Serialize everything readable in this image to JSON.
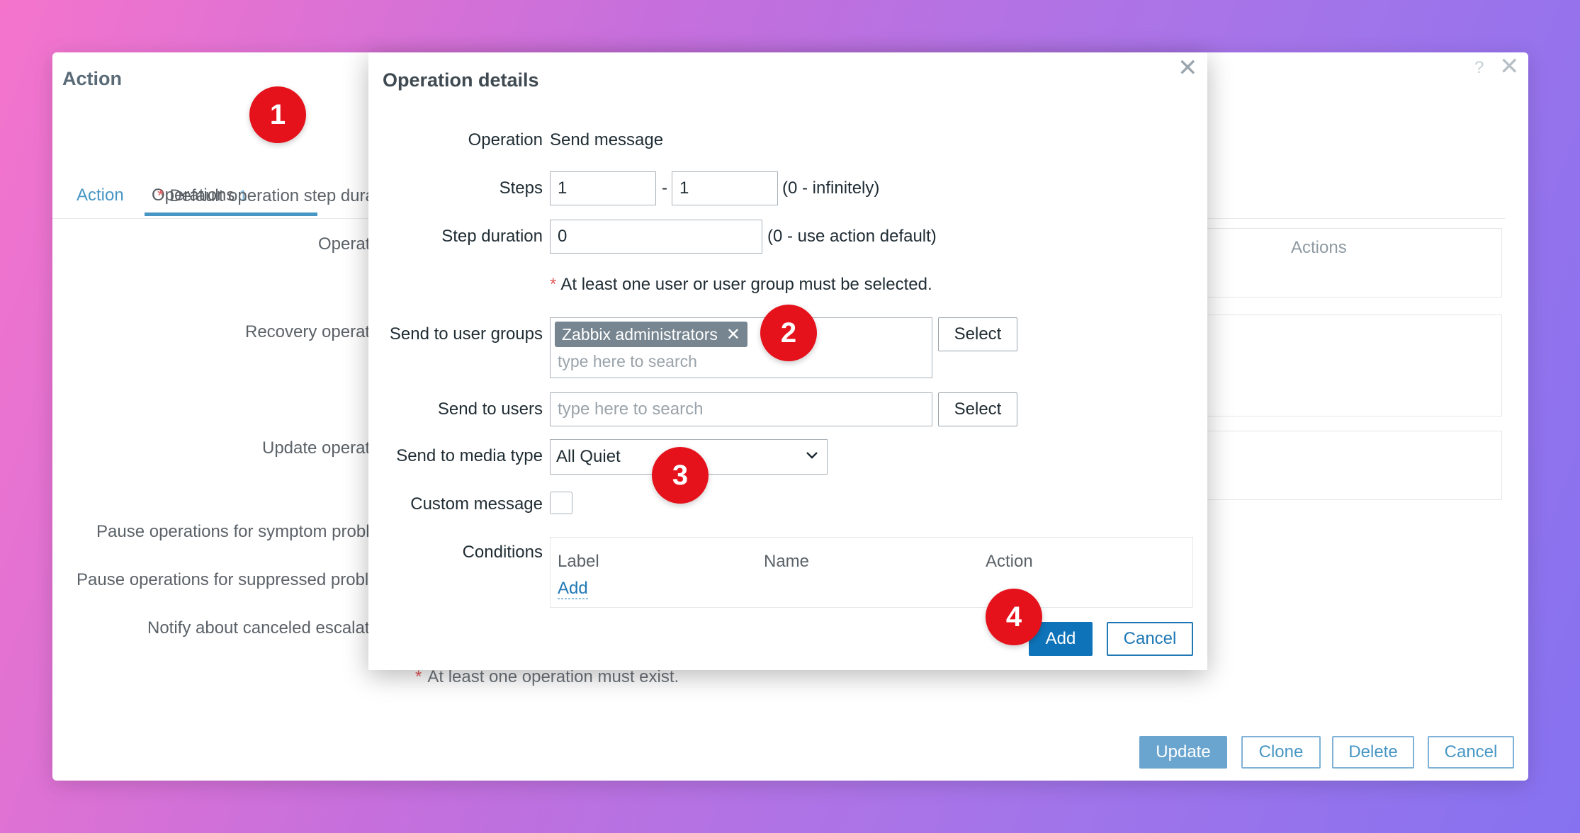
{
  "window": {
    "title": "Action",
    "help_icon": "?",
    "close_icon": "✕",
    "tabs": [
      {
        "label": "Action"
      },
      {
        "label": "Operations",
        "count": "1"
      }
    ],
    "labels": {
      "default_step": "Default operation step dura",
      "operations": "Operat",
      "recovery": "Recovery operat",
      "update": "Update operat",
      "pause_symptom": "Pause operations for symptom probl",
      "pause_suppressed": "Pause operations for suppressed probl",
      "notify_canceled": "Notify about canceled escalat"
    },
    "required_mark": "*",
    "actions_header": "Actions",
    "note": "At least one operation must exist.",
    "buttons": {
      "update": "Update",
      "clone": "Clone",
      "delete": "Delete",
      "cancel": "Cancel"
    }
  },
  "modal": {
    "title": "Operation details",
    "close_icon": "✕",
    "operation": {
      "label": "Operation",
      "value": "Send message"
    },
    "steps": {
      "label": "Steps",
      "from": "1",
      "separator": "-",
      "to": "1",
      "hint": "(0 - infinitely)"
    },
    "step_duration": {
      "label": "Step duration",
      "value": "0",
      "hint": "(0 - use action default)"
    },
    "required_note": "At least one user or user group must be selected.",
    "required_mark": "*",
    "user_groups": {
      "label": "Send to user groups",
      "chip": "Zabbix administrators",
      "chip_remove": "✕",
      "placeholder": "type here to search",
      "select_label": "Select"
    },
    "users": {
      "label": "Send to users",
      "placeholder": "type here to search",
      "select_label": "Select"
    },
    "media_type": {
      "label": "Send to media type",
      "value": "All Quiet"
    },
    "custom_message": {
      "label": "Custom message",
      "checked": false
    },
    "conditions": {
      "label": "Conditions",
      "columns": [
        "Label",
        "Name",
        "Action"
      ],
      "add_link": "Add"
    },
    "buttons": {
      "add": "Add",
      "cancel": "Cancel"
    }
  },
  "callouts": [
    "1",
    "2",
    "3",
    "4"
  ],
  "colors": {
    "callout": "#e5121c",
    "primary": "#0e73b8",
    "required": "#e45959"
  }
}
